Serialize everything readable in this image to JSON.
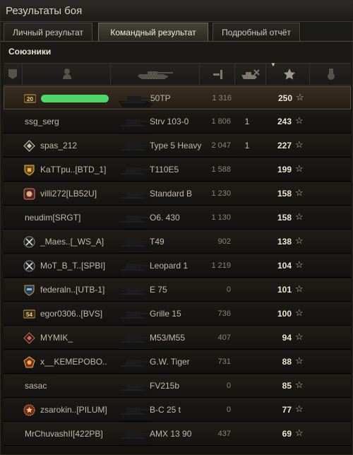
{
  "window": {
    "title": "Результаты боя"
  },
  "tabs": [
    {
      "label": "Личный результат",
      "active": false
    },
    {
      "label": "Командный результат",
      "active": true
    },
    {
      "label": "Подробный отчёт",
      "active": false
    }
  ],
  "section": {
    "label": "Союзники"
  },
  "columns": [
    {
      "id": "badge",
      "icon": "badge-icon"
    },
    {
      "id": "player",
      "icon": "player-icon"
    },
    {
      "id": "vehicle",
      "icon": "tank-icon"
    },
    {
      "id": "damage",
      "icon": "damage-icon"
    },
    {
      "id": "kills",
      "icon": "kills-icon"
    },
    {
      "id": "xp",
      "icon": "xp-star-icon",
      "sorted": "descending"
    },
    {
      "id": "medal",
      "icon": "medal-icon"
    }
  ],
  "players": [
    {
      "name": "",
      "redacted": true,
      "badge": "level-20-badge",
      "badge_text": "20",
      "vehicle": "50TP",
      "damage": "1 316",
      "kills": "",
      "xp": "250",
      "self": true
    },
    {
      "name": "ssg_serg",
      "badge": "",
      "vehicle": "Strv 103-0",
      "damage": "1 806",
      "kills": "1",
      "xp": "243"
    },
    {
      "name": "spas_212",
      "badge": "diamond-badge",
      "vehicle": "Type 5 Heavy",
      "damage": "2 047",
      "kills": "1",
      "xp": "227"
    },
    {
      "name": "KaTTpu..[BTD_1]",
      "badge": "gold-shield-badge",
      "vehicle": "T110E5",
      "damage": "1 588",
      "kills": "",
      "xp": "199"
    },
    {
      "name": "villi272[LB52U]",
      "badge": "red-clan-badge",
      "vehicle": "Standard B",
      "damage": "1 230",
      "kills": "",
      "xp": "158"
    },
    {
      "name": "neudim[SRGT]",
      "badge": "",
      "vehicle": "O6. 430",
      "damage": "1 130",
      "kills": "",
      "xp": "158"
    },
    {
      "name": "_Maes..[_WS_A]",
      "badge": "crossed-swords-badge",
      "vehicle": "T49",
      "damage": "902",
      "kills": "",
      "xp": "138"
    },
    {
      "name": "MoT_B_T..[SPBI]",
      "badge": "crossed-swords-badge",
      "vehicle": "Leopard 1",
      "damage": "1 219",
      "kills": "",
      "xp": "104"
    },
    {
      "name": "federaln..[UTB-1]",
      "badge": "blue-shield-badge",
      "vehicle": "E 75",
      "damage": "0",
      "kills": "",
      "xp": "101"
    },
    {
      "name": "egor0306..[BVS]",
      "badge": "level-54-badge",
      "badge_text": "54",
      "vehicle": "Grille 15",
      "damage": "736",
      "kills": "",
      "xp": "100"
    },
    {
      "name": "MYMIK_",
      "badge": "red-diamond-badge",
      "vehicle": "M53/M55",
      "damage": "407",
      "kills": "",
      "xp": "94"
    },
    {
      "name": "x__KEMEPOBO..",
      "badge": "pentagon-badge",
      "vehicle": "G.W. Tiger",
      "damage": "731",
      "kills": "",
      "xp": "88"
    },
    {
      "name": "sasac",
      "badge": "",
      "vehicle": "FV215b",
      "damage": "0",
      "kills": "",
      "xp": "85"
    },
    {
      "name": "zsarokin..[PILUM]",
      "badge": "gear-star-badge",
      "vehicle": "B-C 25 t",
      "damage": "0",
      "kills": "",
      "xp": "77"
    },
    {
      "name": "MrChuvashII[422PB]",
      "badge": "",
      "vehicle": "AMX 13 90",
      "damage": "437",
      "kills": "",
      "xp": "69"
    }
  ],
  "colors": {
    "accent": "#c9a04a",
    "self_row": "#3a2e22",
    "redaction": "#4dd86a"
  }
}
